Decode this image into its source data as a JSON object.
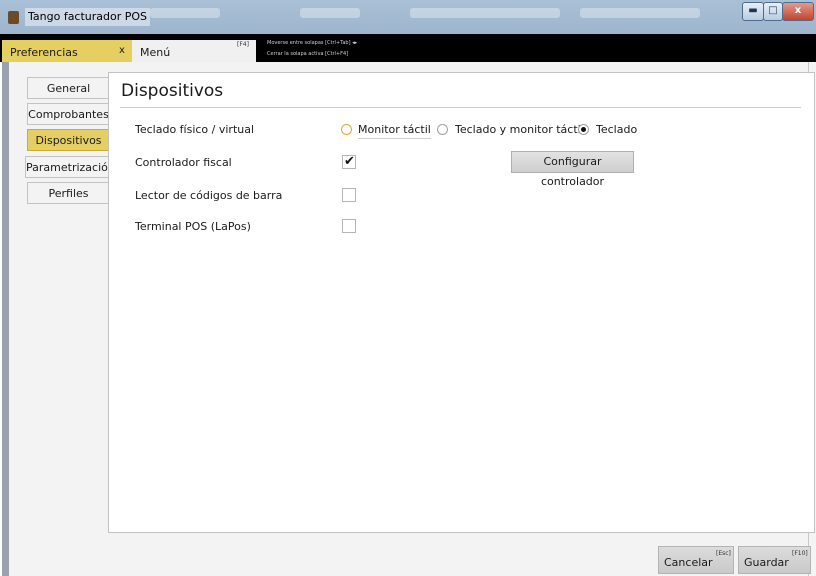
{
  "window": {
    "title": "Tango facturador POS",
    "minimize_glyph": "▬",
    "maximize_glyph": "□",
    "close_glyph": "x"
  },
  "tabs": {
    "preferencias": {
      "label": "Preferencias",
      "close": "x"
    },
    "menu": {
      "label": "Menú",
      "shortcut": "[F4]"
    }
  },
  "hints": {
    "line1": "Moverse entre solapas [Ctrl+Tab] ◂▸",
    "line2": "Cerrar la solapa activa [Ctrl+F4]"
  },
  "sidebar": {
    "items": [
      {
        "label": "General"
      },
      {
        "label": "Comprobantes"
      },
      {
        "label": "Dispositivos",
        "active": true
      },
      {
        "label": "Parametrización"
      },
      {
        "label": "Perfiles"
      }
    ]
  },
  "main": {
    "title": "Dispositivos",
    "rows": {
      "teclado": {
        "label": "Teclado físico / virtual",
        "options": [
          "Monitor táctil",
          "Teclado y monitor táctil",
          "Teclado"
        ],
        "selected": "Teclado"
      },
      "controlador": {
        "label": "Controlador fiscal",
        "checked": true,
        "button": "Configurar controlador"
      },
      "lector": {
        "label": "Lector de códigos de barra",
        "checked": false
      },
      "terminal": {
        "label": "Terminal POS (LaPos)",
        "checked": false
      }
    }
  },
  "footer": {
    "cancel": {
      "label": "Cancelar",
      "shortcut": "[Esc]"
    },
    "save": {
      "label": "Guardar",
      "shortcut": "[F10]"
    }
  },
  "colors": {
    "accent_yellow": "#e6cf62",
    "titlebar": "#a9c0d6",
    "tabstrip": "#000000",
    "radio_focus": "#e3a33a"
  },
  "icons": [
    "app-icon",
    "minimize-icon",
    "maximize-icon",
    "close-icon",
    "checkmark-icon"
  ]
}
